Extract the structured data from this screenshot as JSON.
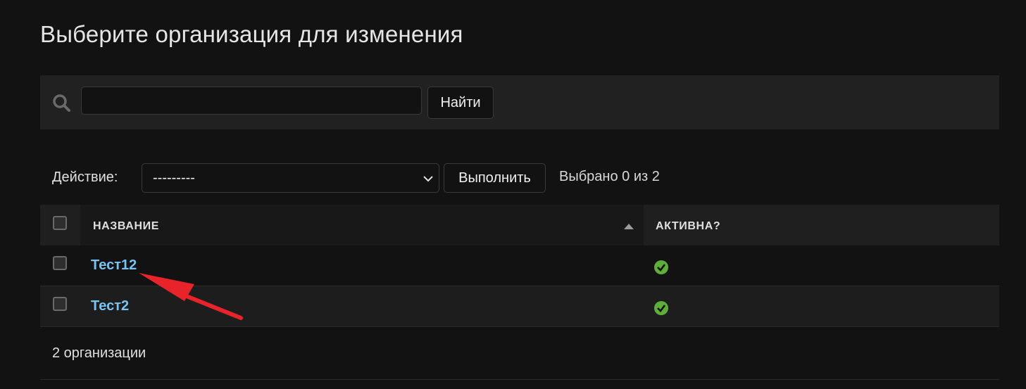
{
  "page": {
    "title": "Выберите организация для изменения"
  },
  "search": {
    "value": "",
    "placeholder": "",
    "button_label": "Найти"
  },
  "actions": {
    "label": "Действие:",
    "selected_option": "---------",
    "run_label": "Выполнить",
    "selection_counter": "Выбрано 0 из 2"
  },
  "table": {
    "columns": [
      "НАЗВАНИЕ",
      "АКТИВНА?"
    ],
    "sorted_column": "НАЗВАНИЕ",
    "sort_direction": "ascending",
    "rows": [
      {
        "name": "Тест12",
        "active": true,
        "active_icon": "check-circle-icon"
      },
      {
        "name": "Тест2",
        "active": true,
        "active_icon": "check-circle-icon"
      }
    ]
  },
  "footer": {
    "count_text": "2 организации"
  },
  "colors": {
    "background": "#121212",
    "link": "#79c3f2",
    "active_check": "#5fae3a",
    "annotation_arrow": "#e8232a"
  },
  "annotations": {
    "arrow": "red arrow pointing to Тест12"
  }
}
